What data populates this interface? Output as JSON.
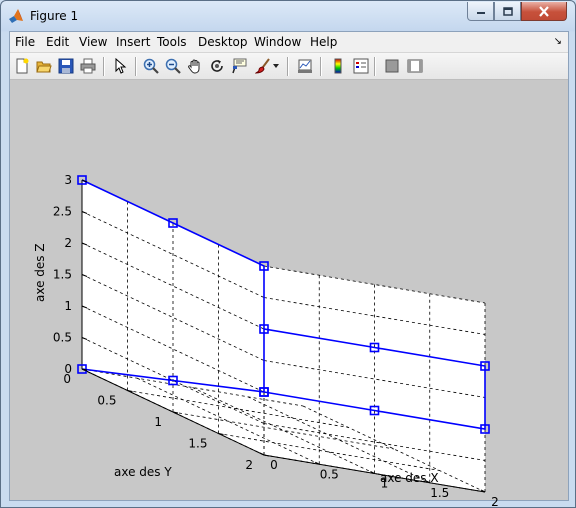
{
  "window": {
    "title": "Figure 1"
  },
  "menu": [
    "File",
    "Edit",
    "View",
    "Insert",
    "Tools",
    "Desktop",
    "Window",
    "Help"
  ],
  "toolbar": [
    {
      "name": "new-figure-icon"
    },
    {
      "name": "open-file-icon"
    },
    {
      "name": "save-icon"
    },
    {
      "name": "print-icon"
    },
    {
      "name": "edit-plot-arrow-icon"
    },
    {
      "name": "zoom-in-icon"
    },
    {
      "name": "zoom-out-icon"
    },
    {
      "name": "pan-hand-icon"
    },
    {
      "name": "rotate-3d-icon"
    },
    {
      "name": "data-cursor-icon"
    },
    {
      "name": "brush-icon"
    },
    {
      "name": "link-plot-icon"
    },
    {
      "name": "insert-colorbar-icon"
    },
    {
      "name": "insert-legend-icon"
    },
    {
      "name": "hide-plot-tools-icon"
    },
    {
      "name": "show-plot-tools-icon"
    }
  ],
  "chart_data": {
    "type": "line",
    "projection": "3d",
    "xlabel": "axe des X",
    "ylabel": "axe des Y",
    "zlabel": "axe des Z",
    "xlim": [
      0,
      2
    ],
    "ylim": [
      0,
      2
    ],
    "zlim": [
      0,
      3
    ],
    "xticks": [
      "0",
      "0.5",
      "1",
      "1.5",
      "2"
    ],
    "yticks": [
      "0",
      "0.5",
      "1",
      "1.5",
      "2"
    ],
    "zticks": [
      "0",
      "0.5",
      "1",
      "1.5",
      "2",
      "2.5",
      "3"
    ],
    "grid": true,
    "color": "#0000ff",
    "marker": "square",
    "series": [
      {
        "points": [
          [
            0,
            0,
            0
          ],
          [
            0,
            1,
            0.5
          ],
          [
            0,
            2,
            1
          ],
          [
            0,
            2,
            2
          ],
          [
            1,
            2,
            2
          ],
          [
            2,
            2,
            2
          ],
          [
            2,
            2,
            1
          ],
          [
            1,
            2,
            1
          ],
          [
            0,
            2,
            1
          ],
          [
            0,
            2,
            3
          ],
          [
            0,
            1,
            3
          ],
          [
            0,
            0,
            3
          ]
        ]
      }
    ]
  }
}
